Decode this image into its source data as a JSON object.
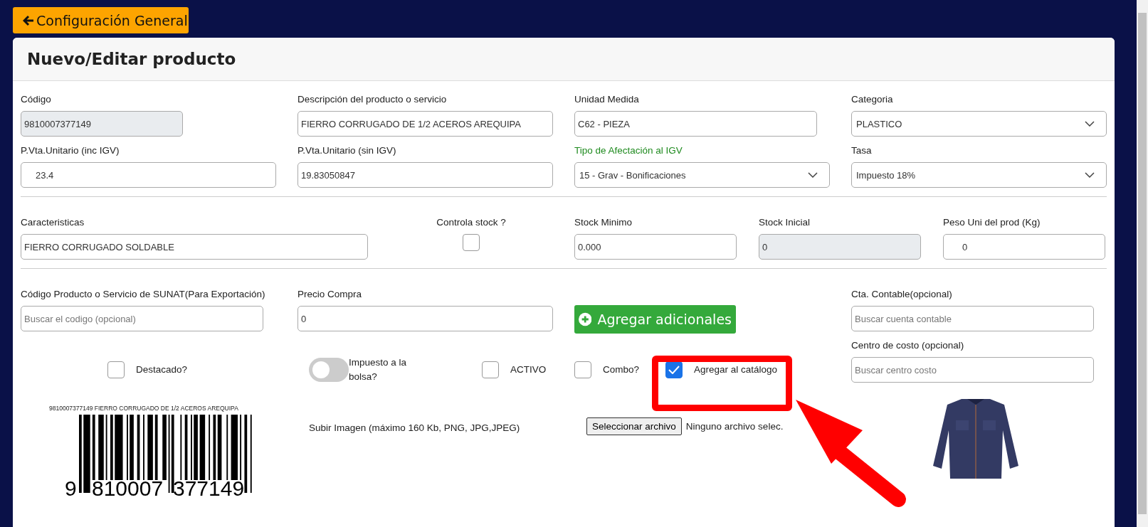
{
  "back_button": {
    "label": "Configuración General"
  },
  "title": "Nuevo/Editar producto",
  "rows": [
    [
      {
        "kind": "input",
        "label": "Código",
        "value": "9810007377149",
        "disabled": true
      },
      {
        "kind": "input",
        "label": "Descripción del producto o servicio",
        "value": "FIERRO CORRUGADO DE 1/2 ACEROS AREQUIPA",
        "disabled": false
      },
      {
        "kind": "input",
        "label": "Unidad Medida",
        "value": "C62 - PIEZA",
        "disabled": false
      },
      {
        "kind": "select",
        "label": "Categoria",
        "value": "PLASTICO"
      }
    ],
    [
      {
        "kind": "input",
        "label": "P.Vta.Unitario (inc IGV)",
        "value": "23.4",
        "disabled": false
      },
      {
        "kind": "input",
        "label": "P.Vta.Unitario (sin IGV)",
        "value": "19.83050847",
        "disabled": false
      },
      {
        "kind": "select",
        "label": "Tipo de Afectación al IGV",
        "value": "15 - Grav - Bonificaciones",
        "highlighted": true
      },
      {
        "kind": "select",
        "label": "Tasa",
        "value": "Impuesto 18%",
        "highlighted": false
      }
    ],
    [
      {
        "kind": "input",
        "label": "Caracteristicas",
        "value": "FIERRO CORRUGADO SOLDABLE",
        "disabled": false
      },
      {
        "kind": "checkbox",
        "label": "Controla stock ?",
        "checked": false
      },
      {
        "kind": "input",
        "label": "Stock Minimo",
        "value": "0.000",
        "disabled": false
      },
      {
        "kind": "input",
        "label": "Stock Inicial",
        "value": "0",
        "disabled": true
      },
      {
        "kind": "input",
        "label": "Peso Uni del prod (Kg)",
        "value": "0",
        "disabled": false
      }
    ]
  ],
  "sunat": {
    "label": "Código Producto o Servicio de SUNAT(Para Exportación)",
    "placeholder": "Buscar el codigo (opcional)"
  },
  "precio_compra": {
    "label": "Precio Compra",
    "value": "0"
  },
  "add_button": {
    "label": "Agregar adicionales"
  },
  "cta_contable": {
    "label": "Cta. Contable(opcional)",
    "placeholder": "Buscar cuenta contable"
  },
  "centro_costo": {
    "label": "Centro de costo (opcional)",
    "placeholder": "Buscar centro costo"
  },
  "options": [
    {
      "kind": "checkbox",
      "label": "Destacado?",
      "checked": false
    },
    {
      "kind": "toggle",
      "label": "Impuesto a la bolsa?",
      "on": false
    },
    {
      "kind": "checkbox",
      "label": "ACTIVO",
      "checked": false
    },
    {
      "kind": "checkbox",
      "label": "Combo?",
      "checked": false
    },
    {
      "kind": "checkbox",
      "label": "Agregar al catálogo",
      "checked": true
    }
  ],
  "barcode": {
    "caption": "9810007377149 FIERRO CORRUGADO DE 1/2 ACEROS AREQUIPA",
    "digits": [
      "9",
      "810007",
      "377149"
    ]
  },
  "upload": {
    "hint": "Subir Imagen (máximo 160 Kb, PNG, JPG,JPEG)",
    "button": "Seleccionar archivo",
    "status": "Ninguno archivo selec."
  }
}
